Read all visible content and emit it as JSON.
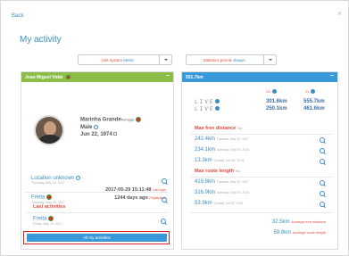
{
  "window": {
    "back_label": "Back",
    "close_label": "×",
    "title": "My activity"
  },
  "controls": {
    "unit_system": {
      "label": "Unit system",
      "value": "Metric"
    },
    "statistics_period": {
      "label": "Statistics period",
      "value": "Always"
    }
  },
  "profile_panel": {
    "header_name": "Joao Miguel Vidal",
    "minimize": "−",
    "location": "Marinha Grande",
    "country": "Portugal",
    "gender": "Male",
    "birthdate": "Jun 22, 1974",
    "last_login_time": "2017-05-29 15:11:48",
    "last_login_label": "Last login",
    "registration_text": "1244 days ago",
    "registration_label": "Registration",
    "activities_title": "Last activities",
    "activities": [
      {
        "name": "Freita",
        "date": "Friday, May 19, 2017"
      },
      {
        "name": "Location unknown",
        "date": "Thursday, May 18, 2017"
      },
      {
        "name": "Freita",
        "date": "Thursday, May 18, 2017"
      }
    ],
    "all_activities_button": "All my activities"
  },
  "stats_panel": {
    "header_title": "551.7km",
    "minimize": "−",
    "col_labels": {
      "xc": "XC",
      "xl": "XL"
    },
    "live_rows": [
      {
        "brand": "LIVE",
        "xc": "301.6km",
        "xl": "555.7km"
      },
      {
        "brand": "LIVE",
        "xc": "250.1km",
        "xl": "461.6km"
      }
    ],
    "max_free_distance": {
      "title": "Max free distance",
      "qualifier": "Top",
      "rows": [
        {
          "value": "242.4km",
          "date": "Tuesday, May 02, 2017"
        },
        {
          "value": "234.1km",
          "date": "Saturday, Sep 03, 2016"
        },
        {
          "value": "13.3km",
          "date": "Sunday, Jun 26, 2016"
        }
      ]
    },
    "max_route_length": {
      "title": "Max route length",
      "qualifier": "Top",
      "rows": [
        {
          "value": "419.8km",
          "date": "Tuesday, May 02, 2017"
        },
        {
          "value": "316.9km",
          "date": "Saturday, Sep 03, 2016"
        },
        {
          "value": "53.9km",
          "date": "Sunday, Jul 03, 2016"
        }
      ]
    },
    "averages": [
      {
        "value": "32.5km",
        "label": "Average free distance"
      },
      {
        "value": "59.8km",
        "label": "Average route length"
      }
    ]
  }
}
